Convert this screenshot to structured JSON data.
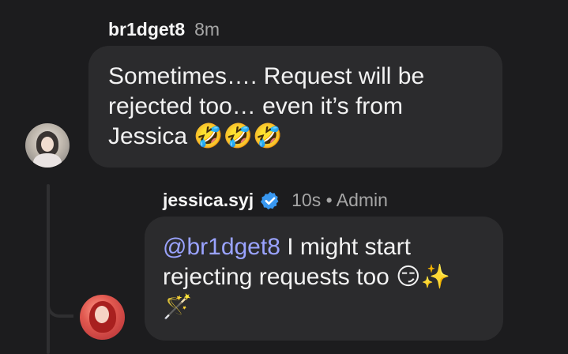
{
  "comments": [
    {
      "username": "br1dget8",
      "time": "8m",
      "text_lines": [
        "Sometimes…. Request will be",
        "rejected too… even it’s from",
        "Jessica"
      ],
      "emojis": "🤣🤣🤣",
      "avatar_icon": "profile-photo-icon"
    },
    {
      "username": "jessica.syj",
      "verified": true,
      "time_meta": "10s • Admin",
      "mention": "@br1dget8",
      "text_after_mention": " I might start",
      "text_line_2": "rejecting requests too ",
      "emojis_line_2": "😏✨",
      "emojis_line_3": "🪄",
      "avatar_icon": "profile-photo-icon"
    }
  ],
  "colors": {
    "background": "#1c1c1e",
    "bubble": "#2b2b2d",
    "mention": "#9aa3ff",
    "verified_badge": "#3897f0",
    "meta_text": "#a6a6a6"
  }
}
